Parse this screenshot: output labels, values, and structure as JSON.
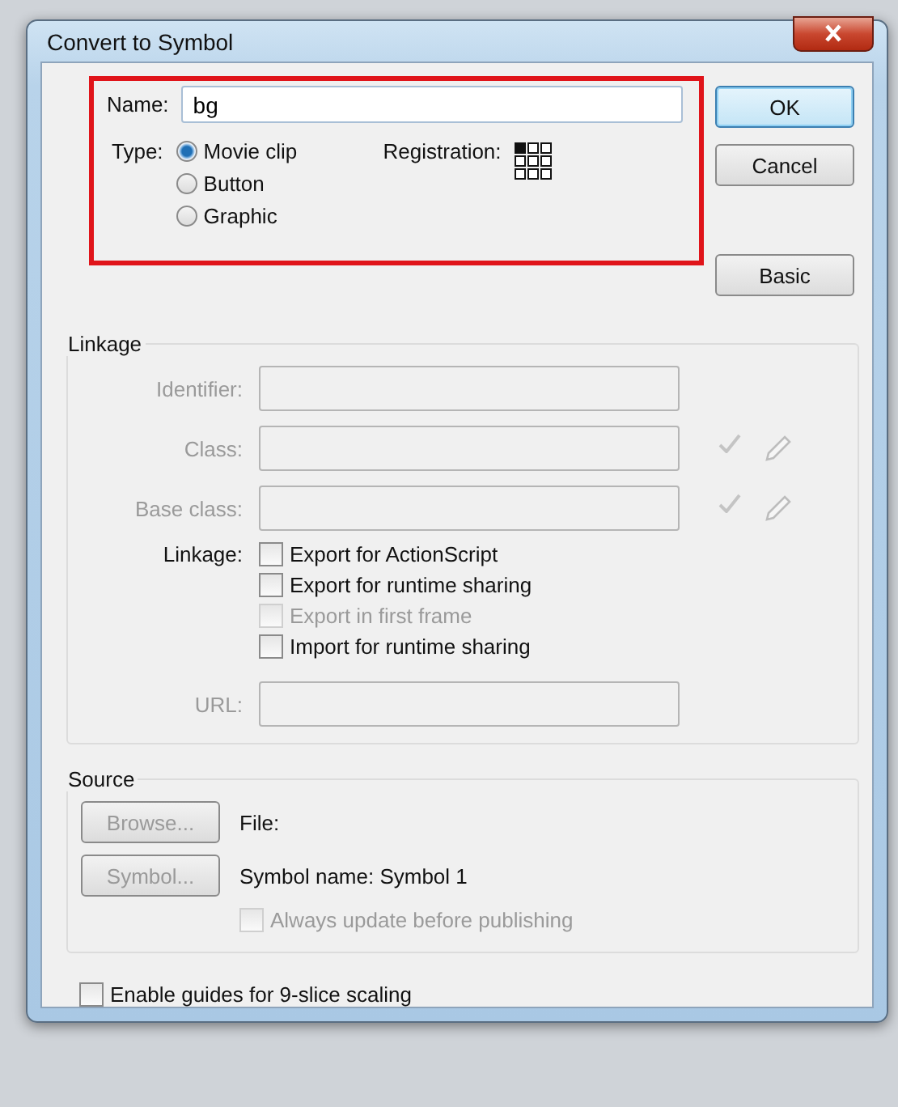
{
  "window": {
    "title": "Convert to Symbol"
  },
  "name": {
    "label": "Name:",
    "value": "bg"
  },
  "type": {
    "label": "Type:",
    "options": [
      {
        "label": "Movie clip",
        "selected": true
      },
      {
        "label": "Button",
        "selected": false
      },
      {
        "label": "Graphic",
        "selected": false
      }
    ]
  },
  "registration": {
    "label": "Registration:",
    "points": [
      {
        "selected": true
      },
      {
        "selected": false
      },
      {
        "selected": false
      },
      {
        "selected": false
      },
      {
        "selected": false
      },
      {
        "selected": false
      },
      {
        "selected": false
      },
      {
        "selected": false
      },
      {
        "selected": false
      }
    ]
  },
  "buttons": [
    {
      "label": "OK",
      "default": true
    },
    {
      "label": "Cancel",
      "default": false
    },
    {
      "label": "Basic",
      "default": false
    }
  ],
  "linkage": {
    "title": "Linkage",
    "fields": [
      {
        "label": "Identifier:",
        "disabled": true
      },
      {
        "label": "Class:",
        "disabled": true,
        "tools": [
          {
            "kind": "check"
          },
          {
            "kind": "pencil"
          }
        ]
      },
      {
        "label": "Base class:",
        "disabled": true,
        "tools": [
          {
            "kind": "check"
          },
          {
            "kind": "pencil"
          }
        ]
      }
    ],
    "options_label": "Linkage:",
    "options": [
      {
        "label": "Export for ActionScript",
        "checked": false,
        "disabled": false
      },
      {
        "label": "Export for runtime sharing",
        "checked": false,
        "disabled": false
      },
      {
        "label": "Export in first frame",
        "checked": false,
        "disabled": true
      },
      {
        "label": "Import for runtime sharing",
        "checked": false,
        "disabled": false
      }
    ],
    "url": {
      "label": "URL:",
      "disabled": true
    }
  },
  "source": {
    "title": "Source",
    "rows": [
      {
        "button": "Browse...",
        "disabled": true,
        "text": "File:"
      },
      {
        "button": "Symbol...",
        "disabled": true,
        "text": "Symbol name: Symbol 1"
      }
    ],
    "option": {
      "label": "Always update before publishing",
      "checked": false,
      "disabled": true
    }
  },
  "nine_slice": {
    "label": "Enable guides for 9-slice scaling",
    "checked": false
  }
}
